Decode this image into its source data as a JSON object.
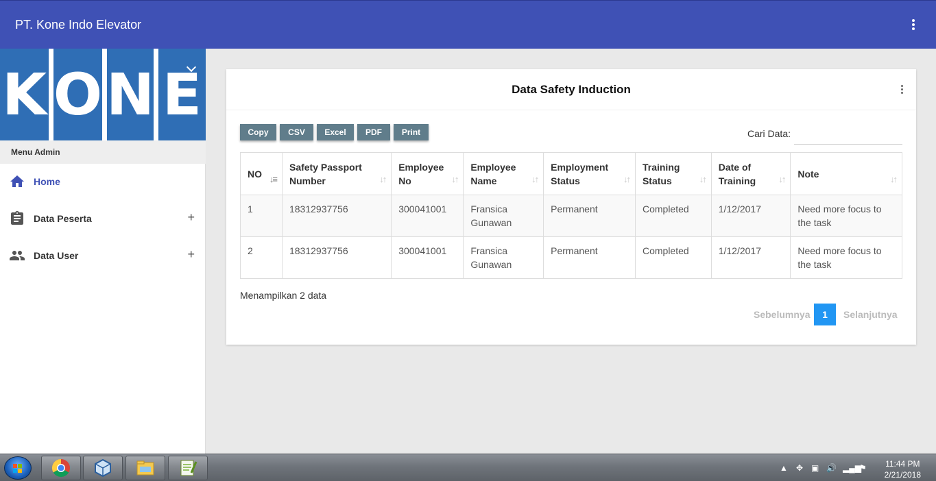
{
  "app": {
    "title": "PT. Kone Indo Elevator"
  },
  "logo": {
    "letters": [
      "K",
      "O",
      "N",
      "E"
    ]
  },
  "sidebar": {
    "section_label": "Menu Admin",
    "items": [
      {
        "label": "Home",
        "icon": "home-icon",
        "active": true,
        "expandable": false
      },
      {
        "label": "Data Peserta",
        "icon": "clipboard-icon",
        "active": false,
        "expandable": true
      },
      {
        "label": "Data User",
        "icon": "people-icon",
        "active": false,
        "expandable": true
      }
    ],
    "expand_symbol": "+"
  },
  "card": {
    "title": "Data Safety Induction",
    "export_buttons": [
      "Copy",
      "CSV",
      "Excel",
      "PDF",
      "Print"
    ],
    "search_label": "Cari Data:",
    "search_value": ""
  },
  "table": {
    "headers": [
      "NO",
      "Safety Passport Number",
      "Employee No",
      "Employee Name",
      "Employment Status",
      "Training Status",
      "Date of Training",
      "Note"
    ],
    "rows": [
      [
        "1",
        "18312937756",
        "300041001",
        "Fransica Gunawan",
        "Permanent",
        "Completed",
        "1/12/2017",
        "Need more focus to the task"
      ],
      [
        "2",
        "18312937756",
        "300041001",
        "Fransica Gunawan",
        "Permanent",
        "Completed",
        "1/12/2017",
        "Need more focus to the task"
      ]
    ]
  },
  "footer": {
    "info": "Menampilkan 2 data",
    "prev": "Sebelumnya",
    "current_page": "1",
    "next": "Selanjutnya"
  },
  "taskbar": {
    "apps": [
      "chrome-icon",
      "virtualbox-icon",
      "file-explorer-icon",
      "notepad-plus-plus-icon"
    ],
    "time": "11:44 PM",
    "date": "2/21/2018"
  },
  "colors": {
    "primary": "#3f51b5",
    "logo_blue": "#2f6eb5",
    "button_grey": "#607d8b",
    "page_active": "#2196f3"
  }
}
